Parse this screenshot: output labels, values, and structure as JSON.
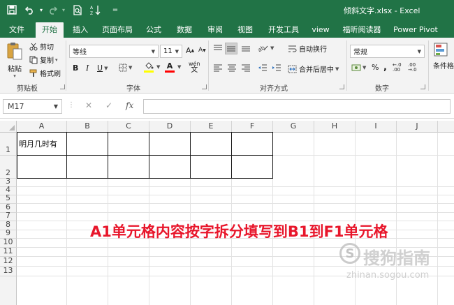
{
  "window": {
    "title": "倾斜文字.xlsx  -  Excel"
  },
  "qat": {
    "save_icon": "save-icon",
    "undo_icon": "undo-icon",
    "redo_icon": "redo-icon",
    "print_preview_icon": "print-preview-icon",
    "sort_icon": "sort-ascending-icon",
    "customize_icon": "customize-qat-icon"
  },
  "tabs": [
    {
      "label": "文件"
    },
    {
      "label": "开始"
    },
    {
      "label": "插入"
    },
    {
      "label": "页面布局"
    },
    {
      "label": "公式"
    },
    {
      "label": "数据"
    },
    {
      "label": "审阅"
    },
    {
      "label": "视图"
    },
    {
      "label": "开发工具"
    },
    {
      "label": "view"
    },
    {
      "label": "福昕阅读器"
    },
    {
      "label": "Power Pivot"
    }
  ],
  "ribbon": {
    "clipboard": {
      "paste": "粘贴",
      "cut": "剪切",
      "copy": "复制",
      "format_painter": "格式刷",
      "group": "剪贴板"
    },
    "font": {
      "name": "等线",
      "size": "11",
      "grow": "A",
      "shrink": "A",
      "bold": "B",
      "italic": "I",
      "underline": "U",
      "font_color_letter": "A",
      "phonetic": "wén",
      "group": "字体",
      "fill_color": "#ffff00",
      "font_color": "#ff0000"
    },
    "alignment": {
      "wrap_text": "自动换行",
      "merge_center": "合并后居中",
      "group": "对齐方式"
    },
    "number": {
      "format": "常规",
      "percent": "%",
      "comma": ",",
      "increase_decimal": "←.0 .00",
      "decrease_decimal": ".00 →.0",
      "group": "数字"
    },
    "styles": {
      "conditional_format": "条件格式"
    }
  },
  "formula_bar": {
    "name_box": "M17",
    "cancel": "✕",
    "enter": "✓",
    "fx": "fx",
    "formula": ""
  },
  "sheet": {
    "columns": [
      "A",
      "B",
      "C",
      "D",
      "E",
      "F",
      "G",
      "H",
      "I",
      "J"
    ],
    "rows": [
      "1",
      "2",
      "3",
      "4",
      "5",
      "6",
      "7",
      "8",
      "9",
      "10",
      "11",
      "12",
      "13"
    ],
    "cells": {
      "A1": "明月几时有"
    }
  },
  "annotation": "A1单元格内容按字拆分填写到B1到F1单元格",
  "watermark": {
    "logo_letter": "S",
    "brand": "搜狗指南",
    "url": "zhinan.sogou.com"
  }
}
